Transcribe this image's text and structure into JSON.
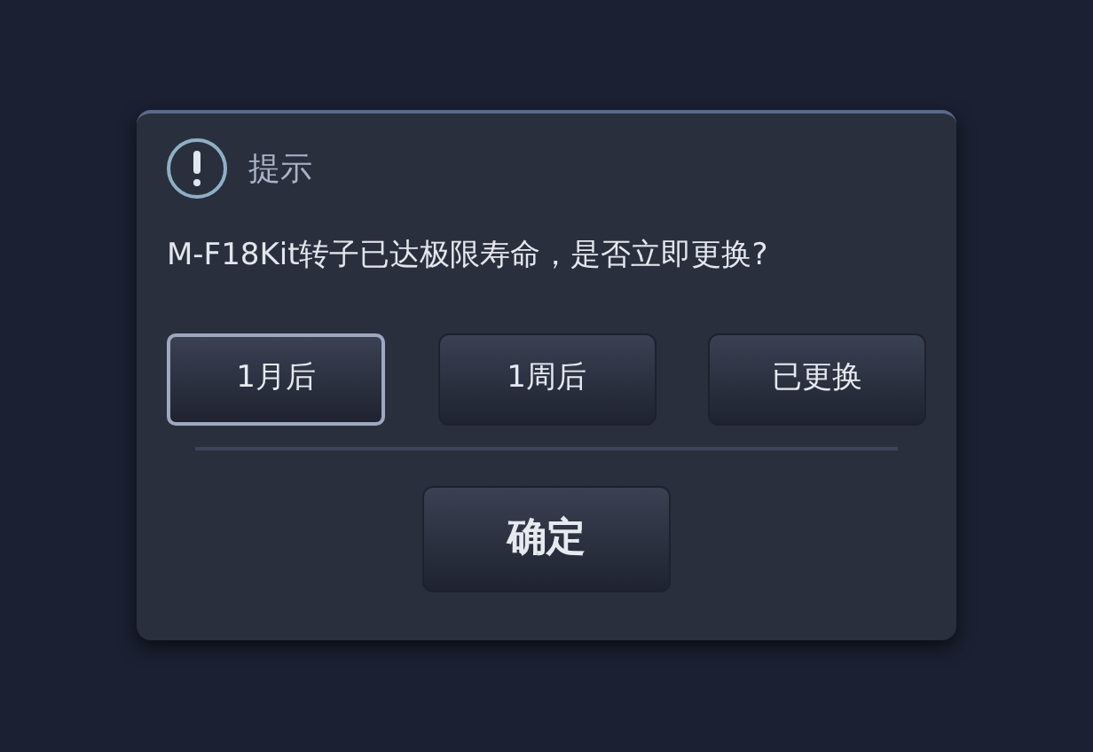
{
  "dialog": {
    "title": "提示",
    "message": "M-F18Kit转子已达极限寿命，是否立即更换?",
    "options": [
      {
        "label": "1月后",
        "selected": true
      },
      {
        "label": "1周后",
        "selected": false
      },
      {
        "label": "已更换",
        "selected": false
      }
    ],
    "confirm": "确定"
  }
}
